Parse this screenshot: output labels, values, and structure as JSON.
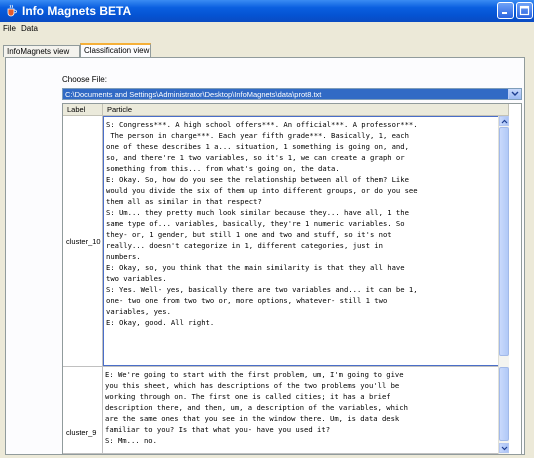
{
  "window": {
    "title": "Info Magnets BETA"
  },
  "menu": {
    "items": [
      "File",
      "Data"
    ]
  },
  "tabs": [
    {
      "label": "InfoMagnets view",
      "selected": false
    },
    {
      "label": "Classification view",
      "selected": true
    }
  ],
  "file_chooser": {
    "label": "Choose File:",
    "value": "C:\\Documents and Settings\\Administrator\\Desktop\\InfoMagnets\\data\\prot8.txt"
  },
  "table": {
    "headers": {
      "label": "Label",
      "particle": "Particle"
    },
    "rows": [
      {
        "label": "cluster_10",
        "lines": [
          "S: Congress***. A high school offers***. An official***. A professor***.",
          " The person in charge***. Each year fifth grade***. Basically, 1, each",
          "one of these describes 1 a... situation, 1 something is going on, and,",
          "so, and there're 1 two variables, so it's 1, we can create a graph or",
          "something from this... from what's going on, the data.",
          "E: Okay. So, how do you see the relationship between all of them? Like",
          "would you divide the six of them up into different groups, or do you see",
          "them all as similar in that respect?",
          "S: Um... they pretty much look similar because they... have all, 1 the",
          "same type of... variables, basically, they're 1 numeric variables. So",
          "they- or, 1 gender, but still 1 one and two and stuff, so it's not",
          "really... doesn't categorize in 1, different categories, just in",
          "numbers.",
          "E: Okay, so, you think that the main similarity is that they all have",
          "two variables.",
          "S: Yes. Well- yes, basically there are two variables and... it can be 1,",
          "one- two one from two two or, more options, whatever- still 1 two",
          "variables, yes.",
          "E: Okay, good. All right."
        ]
      },
      {
        "label": "cluster_9",
        "lines": [
          "E: We're going to start with the first problem, um, I'm going to give",
          "you this sheet, which has descriptions of the two problems you'll be",
          "working through on. The first one is called cities; it has a brief",
          "description there, and then, um, a description of the variables, which",
          "are the same ones that you see in the window there. Um, is data desk",
          "familiar to you? Is that what you- have you used it?",
          "S: Mm... no."
        ]
      }
    ]
  },
  "colors": {
    "titlebar": "#0a5fe0",
    "selection": "#316ac5",
    "tab_highlight": "#f5b03a"
  }
}
